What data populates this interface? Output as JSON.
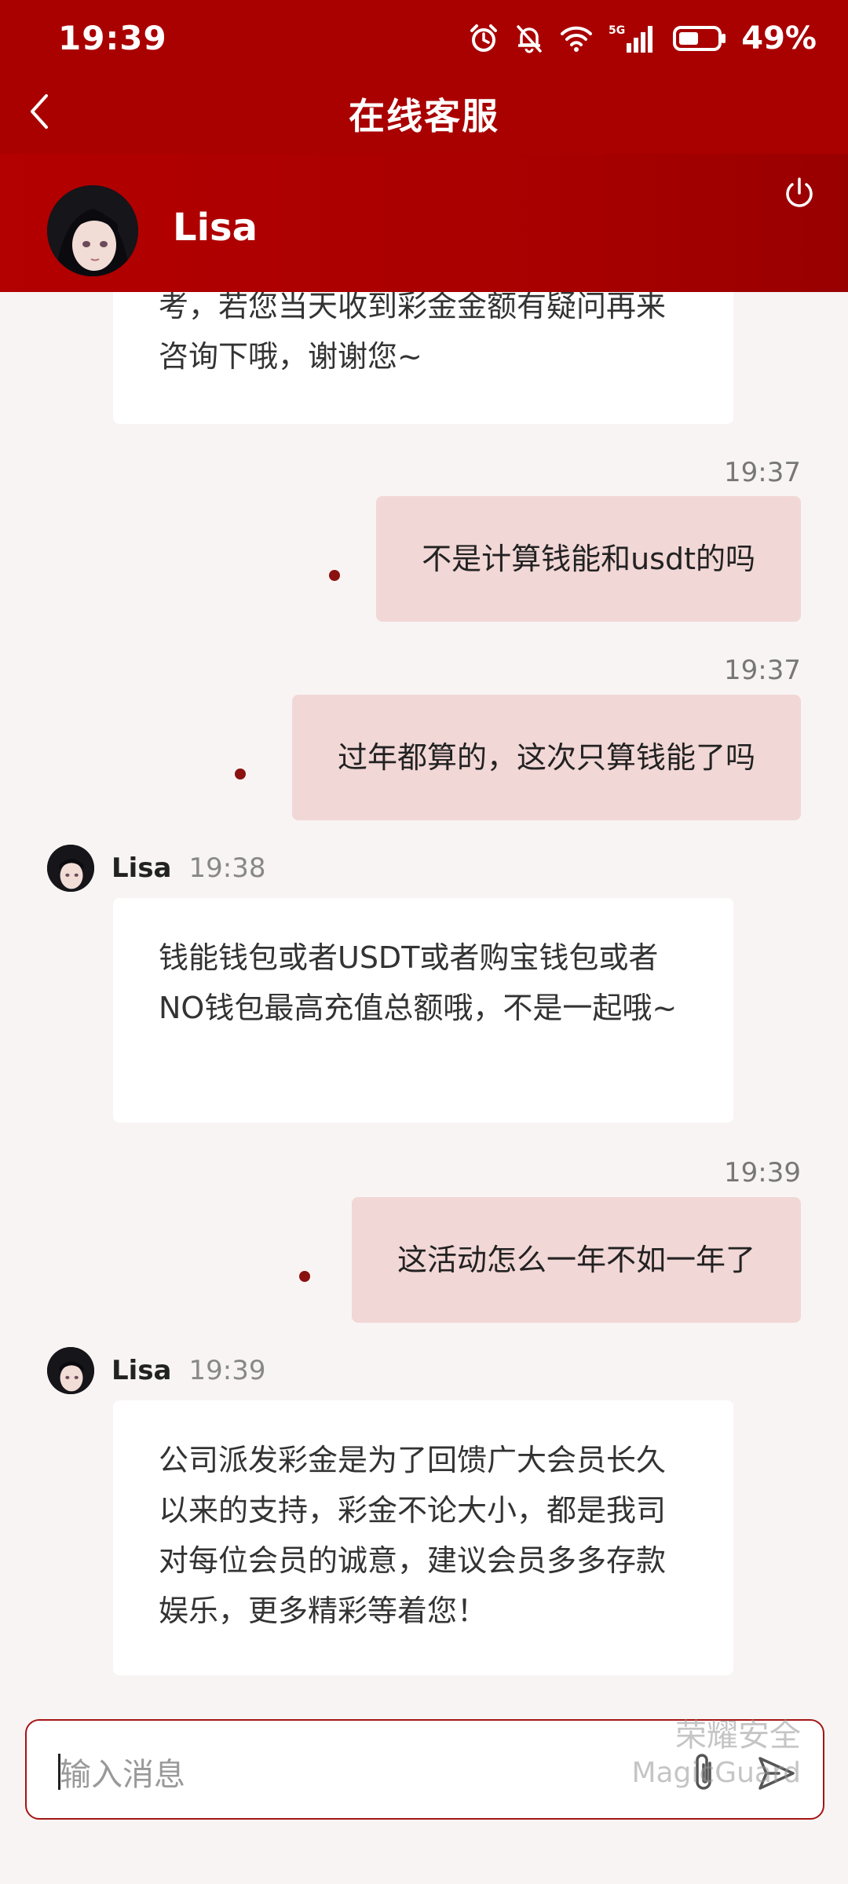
{
  "status_bar": {
    "time": "19:39",
    "network": "5G",
    "battery": "49%"
  },
  "header": {
    "title": "在线客服"
  },
  "agent": {
    "name": "Lisa"
  },
  "messages": {
    "m1": {
      "text": "考，若您当天收到彩金金额有疑问再来咨询下哦，谢谢您~"
    },
    "m2": {
      "time": "19:37",
      "text": "不是计算钱能和usdt的吗"
    },
    "m3": {
      "time": "19:37",
      "text": "过年都算的，这次只算钱能了吗"
    },
    "m4": {
      "sender": "Lisa",
      "time": "19:38",
      "text": "钱能钱包或者USDT或者购宝钱包或者NO钱包最高充值总额哦，不是一起哦~"
    },
    "m5": {
      "time": "19:39",
      "text": "这活动怎么一年不如一年了"
    },
    "m6": {
      "sender": "Lisa",
      "time": "19:39",
      "text": "公司派发彩金是为了回馈广大会员长久以来的支持，彩金不论大小，都是我司对每位会员的诚意，建议会员多多存款娱乐，更多精彩等着您！"
    }
  },
  "input": {
    "placeholder": "输入消息"
  },
  "watermark": {
    "line1": "荣耀安全",
    "line2": "MagicGuard"
  },
  "colors": {
    "primary": "#a90000",
    "outgoing_bubble": "#f1d7d6",
    "incoming_bubble": "#ffffff",
    "background": "#f8f4f3"
  }
}
